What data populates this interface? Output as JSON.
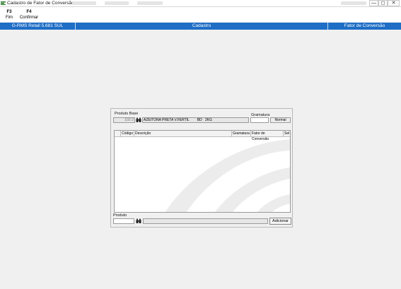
{
  "window": {
    "title": "Cadastro de Fator de Conversão",
    "controls": {
      "minimize": "—",
      "maximize": "◻",
      "close": "✕"
    }
  },
  "toolbar": {
    "items": [
      {
        "key": "F3",
        "label": "Fim"
      },
      {
        "key": "F4",
        "label": "Confirmar"
      }
    ]
  },
  "header": {
    "system": "G-RMS Retail 5.681 SUL",
    "module": "Cadastro",
    "screen": "Fator de Conversão",
    "color": "#1e6ec6"
  },
  "form": {
    "produto_base_label": "Produto Base",
    "produto_base_code": "102-2",
    "produto_base_desc": "AZEITONA PRETA V.FERTIL        BD   2KG",
    "gramatura_label": "Gramatura",
    "gramatura_value": "",
    "normal_label": "Normal",
    "produto_label": "Produto",
    "produto_code": "",
    "produto_desc": "",
    "add_button": "Adicionar",
    "lookup_icon": "binoculars-icon"
  },
  "table": {
    "columns": [
      "Código",
      "Descrição",
      "Gramatura",
      "Fator de Conversão",
      "Sel"
    ],
    "rows": []
  }
}
